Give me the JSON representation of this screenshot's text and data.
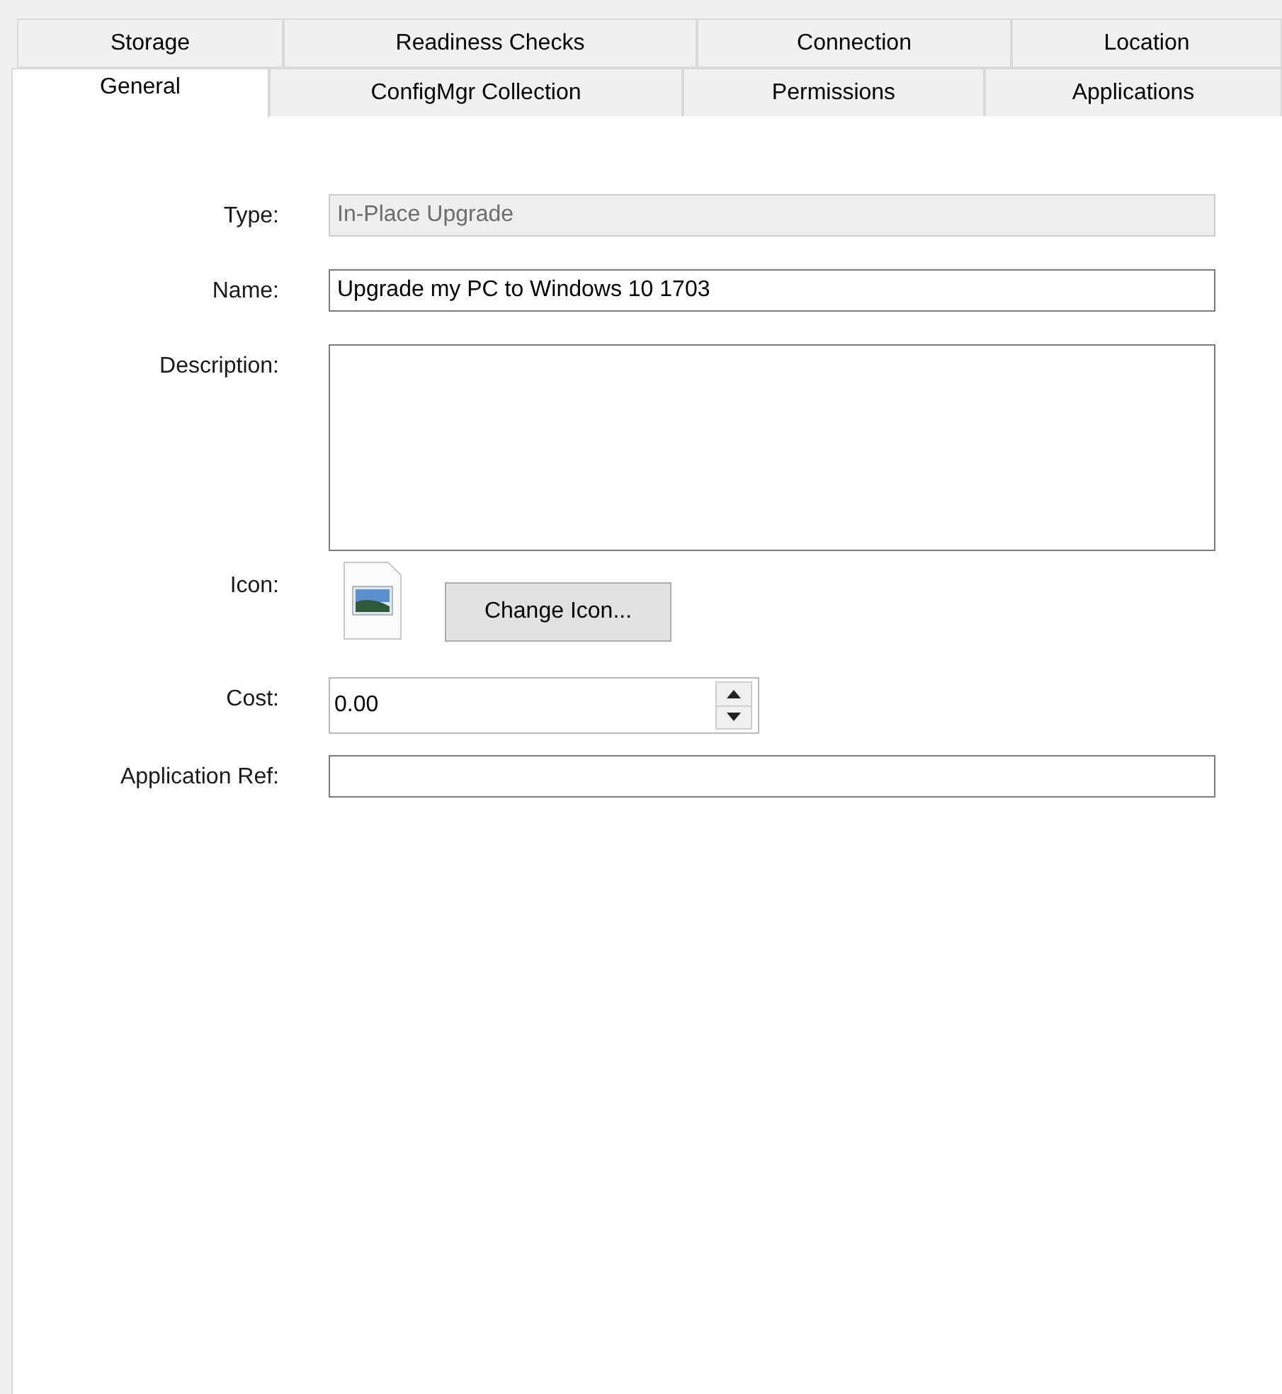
{
  "tab_rows": [
    {
      "tabs": [
        {
          "label": "Storage",
          "selected": false
        },
        {
          "label": "Readiness Checks",
          "selected": false
        },
        {
          "label": "Connection",
          "selected": false
        },
        {
          "label": "Location",
          "selected": false
        }
      ]
    },
    {
      "tabs": [
        {
          "label": "General",
          "selected": true
        },
        {
          "label": "ConfigMgr Collection",
          "selected": false
        },
        {
          "label": "Permissions",
          "selected": false
        },
        {
          "label": "Applications",
          "selected": false
        }
      ]
    }
  ],
  "fields": [
    {
      "kind": "text",
      "label": "Type:",
      "value": "In-Place Upgrade",
      "disabled": true
    },
    {
      "kind": "text",
      "label": "Name:",
      "value": "Upgrade my PC to Windows 10 1703",
      "disabled": false
    },
    {
      "kind": "textarea",
      "label": "Description:",
      "disabled": false
    },
    {
      "kind": "icon",
      "label": "Icon:",
      "button": "Change Icon..."
    },
    {
      "kind": "spinner",
      "label": "Cost:",
      "value": "0.00"
    },
    {
      "kind": "text",
      "label": "Application Ref:",
      "disabled": false
    }
  ]
}
